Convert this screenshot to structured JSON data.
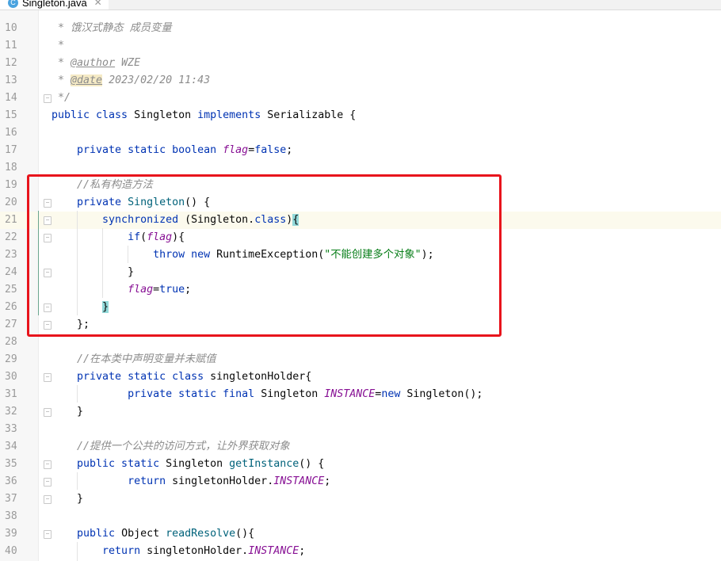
{
  "tab": {
    "icon": "java-class-icon",
    "icon_letter": "C",
    "title": "Singleton.java",
    "close": "✕"
  },
  "editor": {
    "current_line": 21,
    "highlight_box_color": "#e8141c",
    "lines": [
      {
        "n": "10",
        "tokens": [
          [
            " * 饿汉式静态 成员变量",
            "cm"
          ]
        ]
      },
      {
        "n": "11",
        "tokens": [
          [
            " *",
            "cm"
          ]
        ]
      },
      {
        "n": "12",
        "tokens": [
          [
            " * ",
            "cm"
          ],
          [
            "@author",
            "tag"
          ],
          [
            " WZE",
            "cm"
          ]
        ]
      },
      {
        "n": "13",
        "tokens": [
          [
            " * ",
            "cm"
          ],
          [
            "@date",
            "tag tagbg"
          ],
          [
            " 2023/02/20 11:43",
            "cm"
          ]
        ]
      },
      {
        "n": "14",
        "fold": true,
        "tokens": [
          [
            " */",
            "cm"
          ]
        ]
      },
      {
        "n": "15",
        "tokens": [
          [
            "public class ",
            "kw"
          ],
          [
            "Singleton ",
            ""
          ],
          [
            "implements ",
            "kw"
          ],
          [
            "Serializable {",
            ""
          ]
        ]
      },
      {
        "n": "16",
        "tokens": []
      },
      {
        "n": "17",
        "tokens": [
          [
            "    private static boolean ",
            "kw"
          ],
          [
            "flag",
            "fld"
          ],
          [
            "=",
            ""
          ],
          [
            "false",
            "kw"
          ],
          [
            ";",
            ""
          ]
        ]
      },
      {
        "n": "18",
        "tokens": []
      },
      {
        "n": "19",
        "tokens": [
          [
            "    //私有构造方法",
            "cm"
          ]
        ]
      },
      {
        "n": "20",
        "fold": true,
        "tokens": [
          [
            "    private ",
            "kw"
          ],
          [
            "Singleton",
            "fn"
          ],
          [
            "() {",
            ""
          ]
        ]
      },
      {
        "n": "21",
        "fold": true,
        "tokens": [
          [
            "        synchronized ",
            "kw"
          ],
          [
            "(Singleton.",
            ""
          ],
          [
            "class",
            "kw"
          ],
          [
            ")",
            ""
          ],
          [
            "{",
            "brace"
          ]
        ]
      },
      {
        "n": "22",
        "fold": true,
        "tokens": [
          [
            "            if",
            "kw"
          ],
          [
            "(",
            ""
          ],
          [
            "flag",
            "fld"
          ],
          [
            "){",
            ""
          ]
        ]
      },
      {
        "n": "23",
        "tokens": [
          [
            "                throw new ",
            "kw"
          ],
          [
            "RuntimeException(",
            ""
          ],
          [
            "\"不能创建多个对象\"",
            "str"
          ],
          [
            ");",
            ""
          ]
        ]
      },
      {
        "n": "24",
        "fold": true,
        "tokens": [
          [
            "            }",
            ""
          ]
        ]
      },
      {
        "n": "25",
        "tokens": [
          [
            "            ",
            ""
          ],
          [
            "flag",
            "fld"
          ],
          [
            "=",
            ""
          ],
          [
            "true",
            "kw"
          ],
          [
            ";",
            ""
          ]
        ]
      },
      {
        "n": "26",
        "fold": true,
        "tokens": [
          [
            "        ",
            ""
          ],
          [
            "}",
            "brace"
          ]
        ]
      },
      {
        "n": "27",
        "fold": true,
        "tokens": [
          [
            "    };",
            ""
          ]
        ]
      },
      {
        "n": "28",
        "tokens": []
      },
      {
        "n": "29",
        "tokens": [
          [
            "    //在本类中声明变量并未赋值",
            "cm"
          ]
        ]
      },
      {
        "n": "30",
        "fold": true,
        "tokens": [
          [
            "    private static class ",
            "kw"
          ],
          [
            "singletonHolder{",
            ""
          ]
        ]
      },
      {
        "n": "31",
        "tokens": [
          [
            "            private static final ",
            "kw"
          ],
          [
            "Singleton ",
            ""
          ],
          [
            "INSTANCE",
            "fld"
          ],
          [
            "=",
            ""
          ],
          [
            "new ",
            "kw"
          ],
          [
            "Singleton();",
            ""
          ]
        ]
      },
      {
        "n": "32",
        "fold": true,
        "tokens": [
          [
            "    }",
            ""
          ]
        ]
      },
      {
        "n": "33",
        "tokens": []
      },
      {
        "n": "34",
        "tokens": [
          [
            "    //提供一个公共的访问方式，让外界获取对象",
            "cm"
          ]
        ]
      },
      {
        "n": "35",
        "fold": true,
        "tokens": [
          [
            "    public static ",
            "kw"
          ],
          [
            "Singleton ",
            ""
          ],
          [
            "getInstance",
            "fn"
          ],
          [
            "() {",
            ""
          ]
        ]
      },
      {
        "n": "36",
        "fold": true,
        "tokens": [
          [
            "            return ",
            "kw"
          ],
          [
            "singletonHolder.",
            ""
          ],
          [
            "INSTANCE",
            "fld"
          ],
          [
            ";",
            ""
          ]
        ]
      },
      {
        "n": "37",
        "fold": true,
        "tokens": [
          [
            "    }",
            ""
          ]
        ]
      },
      {
        "n": "38",
        "tokens": []
      },
      {
        "n": "39",
        "fold": true,
        "tokens": [
          [
            "    public ",
            "kw"
          ],
          [
            "Object ",
            ""
          ],
          [
            "readResolve",
            "fn"
          ],
          [
            "(){",
            ""
          ]
        ]
      },
      {
        "n": "40",
        "tokens": [
          [
            "        return ",
            "kw"
          ],
          [
            "singletonHolder.",
            ""
          ],
          [
            "INSTANCE",
            "fld"
          ],
          [
            ";",
            ""
          ]
        ]
      }
    ]
  }
}
